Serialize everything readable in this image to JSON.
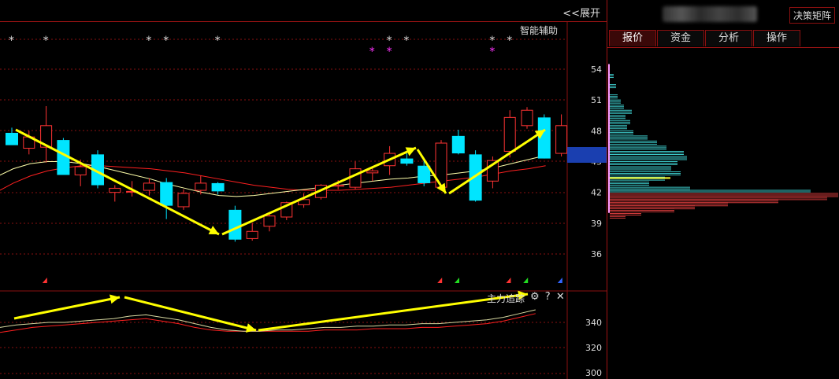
{
  "header": {
    "expand_label": "<<展开",
    "assist_label": "智能辅助"
  },
  "right_panel": {
    "decision_button": "决策矩阵",
    "tabs": [
      {
        "label": "报价",
        "active": true
      },
      {
        "label": "资金",
        "active": false
      },
      {
        "label": "分析",
        "active": false
      },
      {
        "label": "操作",
        "active": false
      }
    ],
    "price_axis_labels": [
      "54",
      "51",
      "48",
      "45",
      "42",
      "39",
      "36"
    ]
  },
  "indicator": {
    "label": "主力追踪",
    "axis_labels": [
      "340",
      "320",
      "300"
    ],
    "icons": [
      "gear-icon",
      "help-icon",
      "close-icon"
    ]
  },
  "colors": {
    "up": "#ff3333",
    "down": "#00e5ff",
    "ma_fast": "#ffffaa",
    "ma_slow": "#ff2020",
    "grid": "#8a1010",
    "arrow": "#ffff00",
    "magenta": "#ff33ff"
  },
  "chart_data": {
    "type": "candlestick",
    "y_axis_labels": [
      54,
      51,
      48,
      45,
      42,
      39,
      36
    ],
    "candles": [
      {
        "o": 47.8,
        "h": 48.3,
        "l": 46.9,
        "c": 46.6,
        "dir": "down"
      },
      {
        "o": 46.3,
        "h": 48.0,
        "l": 45.7,
        "c": 47.4,
        "dir": "up"
      },
      {
        "o": 46.4,
        "h": 50.4,
        "l": 44.9,
        "c": 48.5,
        "dir": "up"
      },
      {
        "o": 47.1,
        "h": 47.3,
        "l": 44.2,
        "c": 43.7,
        "dir": "down"
      },
      {
        "o": 44.5,
        "h": 45.2,
        "l": 42.6,
        "c": 43.7,
        "dir": "up"
      },
      {
        "o": 45.7,
        "h": 46.1,
        "l": 42.4,
        "c": 42.7,
        "dir": "down"
      },
      {
        "o": 42.0,
        "h": 42.7,
        "l": 41.1,
        "c": 42.4,
        "dir": "up"
      },
      {
        "o": 42.1,
        "h": 43.1,
        "l": 41.6,
        "c": 42.1,
        "dir": "up"
      },
      {
        "o": 42.2,
        "h": 43.4,
        "l": 41.7,
        "c": 42.9,
        "dir": "up"
      },
      {
        "o": 43.0,
        "h": 43.4,
        "l": 39.4,
        "c": 40.7,
        "dir": "down"
      },
      {
        "o": 40.6,
        "h": 42.3,
        "l": 40.3,
        "c": 41.9,
        "dir": "up"
      },
      {
        "o": 42.2,
        "h": 43.6,
        "l": 41.8,
        "c": 42.9,
        "dir": "up"
      },
      {
        "o": 42.9,
        "h": 43.0,
        "l": 41.8,
        "c": 42.1,
        "dir": "down"
      },
      {
        "o": 40.3,
        "h": 40.7,
        "l": 37.2,
        "c": 37.4,
        "dir": "down"
      },
      {
        "o": 37.5,
        "h": 39.0,
        "l": 37.3,
        "c": 38.2,
        "dir": "up"
      },
      {
        "o": 38.7,
        "h": 40.0,
        "l": 38.2,
        "c": 39.7,
        "dir": "up"
      },
      {
        "o": 39.6,
        "h": 41.1,
        "l": 39.3,
        "c": 41.0,
        "dir": "up"
      },
      {
        "o": 40.8,
        "h": 41.9,
        "l": 40.5,
        "c": 41.3,
        "dir": "up"
      },
      {
        "o": 41.5,
        "h": 42.8,
        "l": 41.3,
        "c": 42.7,
        "dir": "up"
      },
      {
        "o": 42.6,
        "h": 43.2,
        "l": 42.3,
        "c": 42.7,
        "dir": "up"
      },
      {
        "o": 42.5,
        "h": 45.0,
        "l": 42.3,
        "c": 44.3,
        "dir": "up"
      },
      {
        "o": 43.9,
        "h": 44.5,
        "l": 43.1,
        "c": 44.1,
        "dir": "up"
      },
      {
        "o": 44.6,
        "h": 46.5,
        "l": 43.7,
        "c": 45.8,
        "dir": "up"
      },
      {
        "o": 45.3,
        "h": 45.8,
        "l": 44.6,
        "c": 44.8,
        "dir": "down"
      },
      {
        "o": 44.6,
        "h": 45.2,
        "l": 42.6,
        "c": 42.9,
        "dir": "down"
      },
      {
        "o": 42.5,
        "h": 47.1,
        "l": 42.3,
        "c": 46.8,
        "dir": "up"
      },
      {
        "o": 47.5,
        "h": 48.1,
        "l": 45.7,
        "c": 45.8,
        "dir": "down"
      },
      {
        "o": 45.7,
        "h": 46.1,
        "l": 41.1,
        "c": 41.2,
        "dir": "down"
      },
      {
        "o": 43.1,
        "h": 45.5,
        "l": 42.4,
        "c": 45.1,
        "dir": "up"
      },
      {
        "o": 46.0,
        "h": 50.0,
        "l": 45.4,
        "c": 49.3,
        "dir": "up"
      },
      {
        "o": 48.5,
        "h": 50.3,
        "l": 48.2,
        "c": 50.0,
        "dir": "up"
      },
      {
        "o": 49.3,
        "h": 49.6,
        "l": 45.3,
        "c": 45.3,
        "dir": "down"
      },
      {
        "o": 45.8,
        "h": 49.6,
        "l": 45.5,
        "c": 48.5,
        "dir": "up"
      }
    ],
    "top_markers": [
      {
        "idx": 0,
        "symbol": "*",
        "color": "#dddddd"
      },
      {
        "idx": 2,
        "symbol": "*",
        "color": "#dddddd"
      },
      {
        "idx": 8,
        "symbol": "*",
        "color": "#dddddd"
      },
      {
        "idx": 9,
        "symbol": "*",
        "color": "#dddddd"
      },
      {
        "idx": 12,
        "symbol": "*",
        "color": "#dddddd"
      },
      {
        "idx": 22,
        "symbol": "*",
        "color": "#dddddd"
      },
      {
        "idx": 23,
        "symbol": "*",
        "color": "#dddddd"
      },
      {
        "idx": 28,
        "symbol": "*",
        "color": "#dddddd"
      },
      {
        "idx": 29,
        "symbol": "*",
        "color": "#dddddd"
      },
      {
        "idx": 21,
        "symbol": "*",
        "color": "#ff33ff",
        "row": 2
      },
      {
        "idx": 22,
        "symbol": "*",
        "color": "#ff33ff",
        "row": 2
      },
      {
        "idx": 28,
        "symbol": "*",
        "color": "#ff33ff",
        "row": 2
      }
    ],
    "bottom_markers": [
      {
        "idx": 1,
        "color": "#ff3333"
      },
      {
        "idx": 24,
        "color": "#ff3333"
      },
      {
        "idx": 25,
        "color": "#22dd22"
      },
      {
        "idx": 28,
        "color": "#ff3333"
      },
      {
        "idx": 29,
        "color": "#22dd22"
      },
      {
        "idx": 31,
        "color": "#3366ff"
      }
    ],
    "ma_fast": [
      43.5,
      44.3,
      44.8,
      45.0,
      45.0,
      44.8,
      44.5,
      44.1,
      43.7,
      43.3,
      42.8,
      42.4,
      42.0,
      41.7,
      41.6,
      41.7,
      41.9,
      42.1,
      42.3,
      42.5,
      42.7,
      42.9,
      43.1,
      43.3,
      43.4,
      43.6,
      43.7,
      43.9,
      44.1,
      44.4,
      44.8,
      45.2,
      45.6
    ],
    "ma_slow": [
      42.0,
      42.9,
      43.6,
      44.1,
      44.4,
      44.6,
      44.6,
      44.5,
      44.4,
      44.3,
      44.1,
      43.9,
      43.6,
      43.3,
      43.0,
      42.7,
      42.5,
      42.3,
      42.2,
      42.2,
      42.2,
      42.3,
      42.4,
      42.5,
      42.7,
      42.9,
      43.1,
      43.3,
      43.5,
      43.8,
      44.1,
      44.3,
      44.6
    ],
    "trend_arrows": [
      [
        [
          20,
          165
        ],
        [
          278,
          298
        ]
      ],
      [
        [
          282,
          298
        ],
        [
          528,
          188
        ]
      ],
      [
        [
          530,
          190
        ],
        [
          566,
          246
        ]
      ],
      [
        [
          570,
          246
        ],
        [
          692,
          165
        ]
      ]
    ],
    "volume_profile": [
      {
        "price": 53.5,
        "w": 5,
        "c": "cyan"
      },
      {
        "price": 52.5,
        "w": 8,
        "c": "cyan"
      },
      {
        "price": 51.5,
        "w": 10,
        "c": "cyan"
      },
      {
        "price": 51.0,
        "w": 14,
        "c": "cyan"
      },
      {
        "price": 50.5,
        "w": 18,
        "c": "cyan"
      },
      {
        "price": 50.0,
        "w": 28,
        "c": "cyan"
      },
      {
        "price": 49.5,
        "w": 20,
        "c": "cyan"
      },
      {
        "price": 49.0,
        "w": 26,
        "c": "cyan"
      },
      {
        "price": 48.5,
        "w": 22,
        "c": "cyan"
      },
      {
        "price": 48.0,
        "w": 30,
        "c": "cyan"
      },
      {
        "price": 47.5,
        "w": 48,
        "c": "cyan"
      },
      {
        "price": 47.0,
        "w": 60,
        "c": "cyan"
      },
      {
        "price": 46.5,
        "w": 72,
        "c": "cyan"
      },
      {
        "price": 46.0,
        "w": 94,
        "c": "cyan"
      },
      {
        "price": 45.5,
        "w": 98,
        "c": "cyan"
      },
      {
        "price": 45.0,
        "w": 86,
        "c": "cyan"
      },
      {
        "price": 44.5,
        "w": 78,
        "c": "cyan"
      },
      {
        "price": 44.0,
        "w": 90,
        "c": "cyan"
      },
      {
        "price": 43.5,
        "w": 70,
        "c": "cyan"
      },
      {
        "price": 43.0,
        "w": 50,
        "c": "cyan"
      },
      {
        "price": 42.5,
        "w": 102,
        "c": "cyan"
      },
      {
        "price": 42.2,
        "w": 255,
        "c": "cyan"
      },
      {
        "price": 41.9,
        "w": 290,
        "c": "red"
      },
      {
        "price": 41.6,
        "w": 276,
        "c": "red"
      },
      {
        "price": 41.3,
        "w": 214,
        "c": "red"
      },
      {
        "price": 41.0,
        "w": 150,
        "c": "red"
      },
      {
        "price": 40.7,
        "w": 108,
        "c": "red"
      },
      {
        "price": 40.4,
        "w": 82,
        "c": "red"
      },
      {
        "price": 40.1,
        "w": 40,
        "c": "red"
      },
      {
        "price": 39.8,
        "w": 20,
        "c": "red"
      }
    ],
    "indicator_lines": {
      "y_axis_labels": [
        340,
        320,
        300
      ],
      "yellow": [
        336,
        338,
        339,
        340,
        340,
        341,
        342,
        343,
        345,
        346,
        344,
        342,
        339,
        336,
        334,
        333,
        333,
        334,
        334,
        335,
        336,
        336,
        337,
        337,
        338,
        338,
        339,
        339,
        340,
        341,
        342,
        344,
        347,
        350
      ],
      "red": [
        332,
        334,
        336,
        337,
        338,
        339,
        340,
        341,
        342,
        343,
        341,
        339,
        336,
        334,
        333,
        333,
        333,
        333,
        333,
        333,
        334,
        334,
        334,
        335,
        335,
        335,
        336,
        336,
        337,
        338,
        339,
        341,
        344,
        347
      ]
    },
    "indicator_arrows": [
      [
        [
          18,
          405
        ],
        [
          152,
          378
        ]
      ],
      [
        [
          158,
          378
        ],
        [
          325,
          420
        ]
      ],
      [
        [
          328,
          420
        ],
        [
          670,
          374
        ]
      ]
    ]
  }
}
